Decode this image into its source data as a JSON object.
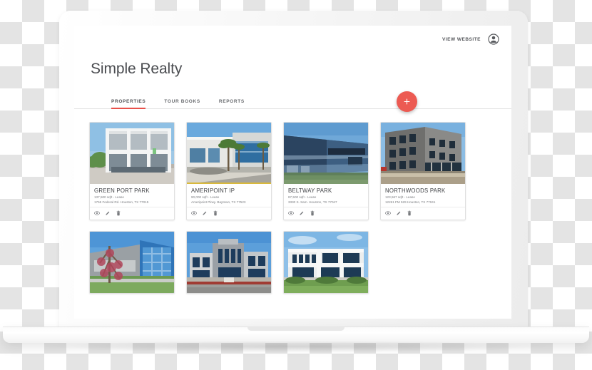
{
  "header": {
    "view_website_label": "VIEW WEBSITE",
    "avatar_icon": "account-circle-icon"
  },
  "page_title": "Simple Realty",
  "tabs": [
    {
      "label": "PROPERTIES",
      "active": true
    },
    {
      "label": "TOUR BOOKS",
      "active": false
    },
    {
      "label": "REPORTS",
      "active": false
    }
  ],
  "fab": {
    "label": "+",
    "name": "add-property-button",
    "color": "#ec5a52"
  },
  "card_actions": [
    {
      "name": "view-icon",
      "title": "View"
    },
    {
      "name": "edit-icon",
      "title": "Edit"
    },
    {
      "name": "delete-icon",
      "title": "Delete"
    }
  ],
  "properties": [
    {
      "name": "GREEN PORT PARK",
      "size": "137,500 sqft - Lease",
      "address": "1755 Federal Rd. Houston, TX 77015",
      "photo": "modern-white-office-building"
    },
    {
      "name": "AMERIPOINT IP",
      "size": "90,000 sqft - Lease",
      "address": "Ameripoint Pkwy. Baytown, TX 77523",
      "photo": "office-building-with-palm-trees"
    },
    {
      "name": "BELTWAY PARK",
      "size": "87,500 sqft - Lease",
      "address": "3330 S. Sam. Houston, TX 77047",
      "photo": "blue-glass-office-building"
    },
    {
      "name": "NORTHWOODS PARK",
      "size": "123,567 sqft - Lease",
      "address": "12261 FM 529 Houston, TX 77041",
      "photo": "grey-stone-corner-office-building"
    },
    {
      "name": "",
      "size": "",
      "address": "",
      "photo": "blue-glass-building-with-tree"
    },
    {
      "name": "",
      "size": "",
      "address": "",
      "photo": "grey-industrial-office-building"
    },
    {
      "name": "",
      "size": "",
      "address": "",
      "photo": "white-two-story-office-building"
    }
  ],
  "colors": {
    "accent": "#e8504a",
    "fab": "#ec5a52",
    "text": "#4a4c50",
    "muted": "#7d7f83"
  }
}
